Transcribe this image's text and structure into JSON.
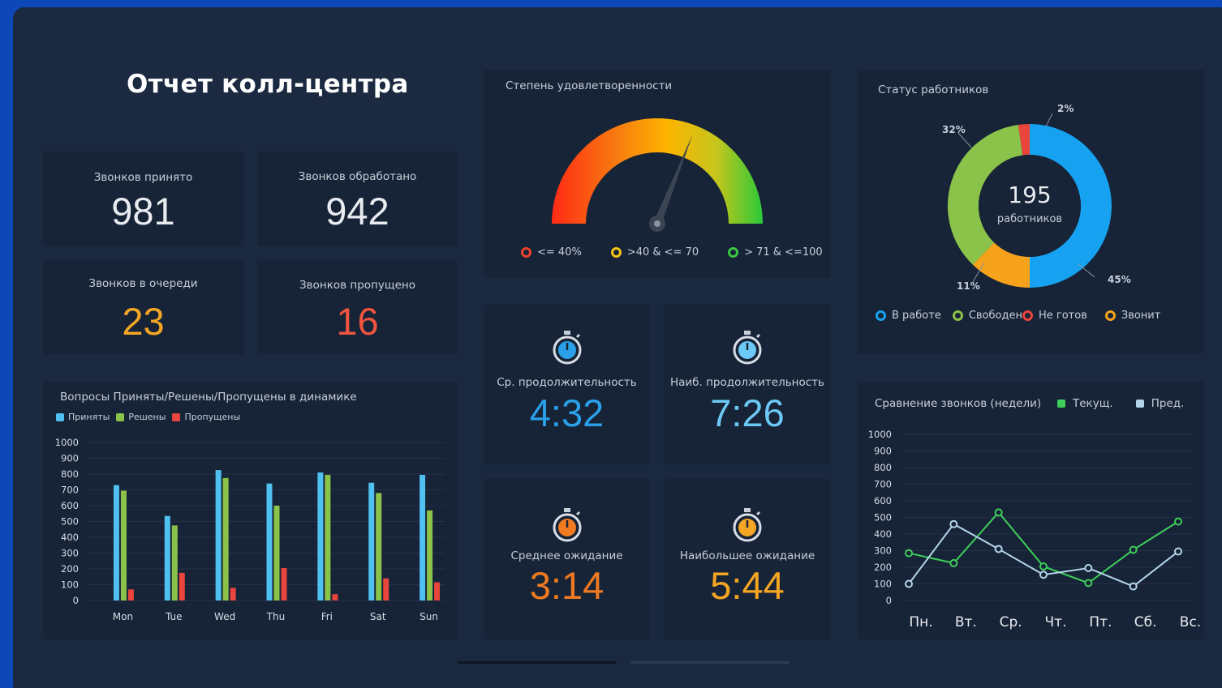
{
  "title": "Отчет колл-центра",
  "kpis": {
    "received": {
      "label": "Звонков принято",
      "value": "981",
      "color": "#e8ecf1"
    },
    "handled": {
      "label": "Звонков обработано",
      "value": "942",
      "color": "#e8ecf1"
    },
    "queued": {
      "label": "Звонков в очереди",
      "value": "23",
      "color": "#f5a623"
    },
    "missed": {
      "label": "Звонков пропущено",
      "value": "16",
      "color": "#f05540"
    }
  },
  "gauge": {
    "title": "Степень удовлетворенности",
    "value_percent": 62,
    "legend": [
      {
        "label": "<= 40%",
        "color": "#f04030",
        "icon": "ring-icon"
      },
      {
        "label": ">40 & <= 70",
        "color": "#f5c518",
        "icon": "ring-icon"
      },
      {
        "label": "> 71 & <=100",
        "color": "#3cc843",
        "icon": "ring-icon"
      }
    ]
  },
  "timers": {
    "avg_duration": {
      "label": "Ср. продолжительность",
      "value": "4:32",
      "color": "#2aa0e8",
      "icon": "stopwatch-icon"
    },
    "max_duration": {
      "label": "Наиб. продолжительность",
      "value": "7:26",
      "color": "#6cc8f5",
      "icon": "stopwatch-icon"
    },
    "avg_wait": {
      "label": "Среднее ожидание",
      "value": "3:14",
      "color": "#f07a20",
      "icon": "stopwatch-icon"
    },
    "max_wait": {
      "label": "Наибольшее ожидание",
      "value": "5:44",
      "color": "#f5a623",
      "icon": "stopwatch-icon"
    }
  },
  "chart_data": [
    {
      "type": "pie",
      "title": "Статус работников",
      "center_value": "195",
      "center_label": "работников",
      "slices": [
        {
          "name": "В работе",
          "value": 45,
          "label": "45%",
          "color": "#16a2f0"
        },
        {
          "name": "Звонит",
          "value": 11,
          "label": "11%",
          "color": "#f7a21b"
        },
        {
          "name": "Свободен",
          "value": 32,
          "label": "32%",
          "color": "#8bc34a"
        },
        {
          "name": "Не готов",
          "value": 2,
          "label": "2%",
          "color": "#e8453c"
        }
      ],
      "legend": [
        {
          "name": "В работе",
          "color": "#16a2f0"
        },
        {
          "name": "Свободен",
          "color": "#8bc34a"
        },
        {
          "name": "Не готов",
          "color": "#e8453c"
        },
        {
          "name": "Звонит",
          "color": "#f7a21b"
        }
      ]
    },
    {
      "type": "bar",
      "title": "Вопросы Приняты/Решены/Пропущены в динамике",
      "categories": [
        "Mon",
        "Tue",
        "Wed",
        "Thu",
        "Fri",
        "Sat",
        "Sun"
      ],
      "series": [
        {
          "name": "Приняты",
          "color": "#4fc0f0",
          "values": [
            730,
            535,
            825,
            740,
            810,
            745,
            795
          ]
        },
        {
          "name": "Решены",
          "color": "#8bc34a",
          "values": [
            695,
            475,
            775,
            600,
            795,
            680,
            570
          ]
        },
        {
          "name": "Пропущены",
          "color": "#e8453c",
          "values": [
            70,
            175,
            80,
            205,
            40,
            140,
            115
          ]
        }
      ],
      "yticks": [
        "1000",
        "900",
        "800",
        "700",
        "600",
        "500",
        "400",
        "300",
        "200",
        "100",
        "0"
      ],
      "ylim": [
        0,
        1000
      ],
      "grid": true
    },
    {
      "type": "line",
      "title": "Сравнение звонков (недели)",
      "categories": [
        "Пн.",
        "Вт.",
        "Ср.",
        "Чт.",
        "Пт.",
        "Сб.",
        "Вс."
      ],
      "series": [
        {
          "name": "Текущ.",
          "color": "#3ecf5a",
          "values": [
            285,
            225,
            530,
            205,
            105,
            305,
            475
          ]
        },
        {
          "name": "Пред.",
          "color": "#b3d4ea",
          "values": [
            100,
            460,
            310,
            155,
            195,
            85,
            295
          ]
        }
      ],
      "yticks": [
        "1000",
        "900",
        "800",
        "700",
        "600",
        "500",
        "400",
        "300",
        "200",
        "100",
        "0"
      ],
      "ylim": [
        0,
        1000
      ],
      "grid": true
    }
  ]
}
